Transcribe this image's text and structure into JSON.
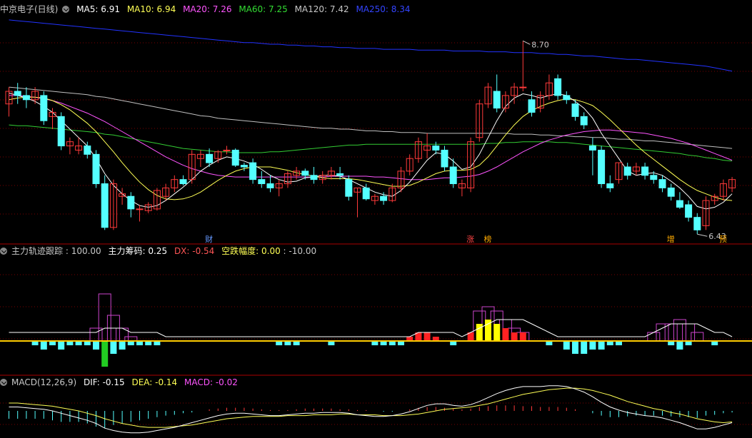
{
  "colors": {
    "bg": "#000000",
    "grid": "#7a0000",
    "up": "#ff3a3a",
    "down": "#54ffff",
    "ma5": "#ffffff",
    "ma10": "#ffff55",
    "ma20": "#ff55ff",
    "ma60": "#33cc33",
    "ma120": "#c0c0c0",
    "ma250": "#2233ff"
  },
  "header": {
    "stock": "中京电子(日线)",
    "ma5": "MA5: 6.91",
    "ma10": "MA10: 6.94",
    "ma20": "MA20: 7.26",
    "ma60": "MA60: 7.25",
    "ma120": "MA120: 7.42",
    "ma250": "MA250: 8.34"
  },
  "indicator": {
    "name": "主力轨迹跟踪",
    "v1": ": 100.00",
    "v2": "主力筹码: 0.25",
    "v3": "DX: -0.54",
    "v4": "空跌幅度: 0.00",
    "v5": ": -10.00"
  },
  "macd": {
    "name": "MACD(12,26,9)",
    "dif": "DIF: -0.15",
    "dea": "DEA: -0.14",
    "macd": "MACD: -0.02"
  },
  "chart_data": {
    "type": "candlestick",
    "price_range": [
      6.3,
      9.0
    ],
    "high_label": "8.70",
    "low_label": "6.43",
    "markers": [
      {
        "idx": 23,
        "text": "财",
        "color": "#6699ff"
      },
      {
        "idx": 53,
        "text": "涨",
        "color": "#ff4444"
      },
      {
        "idx": 55,
        "text": "榜",
        "color": "#ffaa00"
      },
      {
        "idx": 76,
        "text": "增",
        "color": "#ffaa00"
      },
      {
        "idx": 82,
        "text": "预",
        "color": "#ffaa00"
      }
    ],
    "ohlc": [
      [
        7.95,
        8.15,
        7.8,
        8.1
      ],
      [
        8.1,
        8.2,
        7.95,
        8.05
      ],
      [
        8.05,
        8.15,
        7.9,
        8.0
      ],
      [
        8.0,
        8.15,
        7.95,
        8.1
      ],
      [
        8.05,
        8.1,
        7.7,
        7.75
      ],
      [
        7.8,
        7.9,
        7.65,
        7.85
      ],
      [
        7.8,
        7.85,
        7.4,
        7.45
      ],
      [
        7.45,
        7.55,
        7.35,
        7.5
      ],
      [
        7.4,
        7.55,
        7.35,
        7.45
      ],
      [
        7.45,
        7.5,
        7.3,
        7.35
      ],
      [
        7.35,
        7.4,
        6.95,
        7.0
      ],
      [
        7.0,
        7.1,
        6.45,
        6.48
      ],
      [
        6.48,
        7.05,
        6.45,
        7.0
      ],
      [
        6.85,
        6.95,
        6.75,
        6.88
      ],
      [
        6.85,
        6.9,
        6.6,
        6.7
      ],
      [
        6.7,
        6.75,
        6.55,
        6.7
      ],
      [
        6.68,
        6.78,
        6.65,
        6.75
      ],
      [
        6.7,
        6.95,
        6.68,
        6.92
      ],
      [
        6.85,
        7.0,
        6.8,
        6.95
      ],
      [
        6.95,
        7.1,
        6.9,
        7.05
      ],
      [
        7.05,
        7.1,
        6.98,
        7.0
      ],
      [
        7.05,
        7.4,
        7.0,
        7.35
      ],
      [
        7.3,
        7.4,
        7.2,
        7.35
      ],
      [
        7.35,
        7.42,
        7.2,
        7.25
      ],
      [
        7.3,
        7.4,
        7.25,
        7.38
      ],
      [
        7.4,
        7.45,
        7.35,
        7.4
      ],
      [
        7.4,
        7.42,
        7.2,
        7.22
      ],
      [
        7.22,
        7.25,
        7.15,
        7.2
      ],
      [
        7.25,
        7.3,
        7.0,
        7.05
      ],
      [
        7.05,
        7.15,
        6.95,
        7.0
      ],
      [
        7.0,
        7.1,
        6.9,
        6.95
      ],
      [
        6.95,
        7.05,
        6.85,
        7.0
      ],
      [
        7.0,
        7.15,
        6.95,
        7.12
      ],
      [
        7.1,
        7.2,
        7.05,
        7.15
      ],
      [
        7.15,
        7.18,
        7.05,
        7.1
      ],
      [
        7.1,
        7.2,
        7.0,
        7.05
      ],
      [
        7.05,
        7.15,
        7.0,
        7.1
      ],
      [
        7.1,
        7.2,
        7.05,
        7.15
      ],
      [
        7.12,
        7.2,
        7.05,
        7.1
      ],
      [
        7.05,
        7.1,
        6.8,
        6.85
      ],
      [
        6.9,
        6.95,
        6.6,
        6.95
      ],
      [
        6.95,
        7.0,
        6.8,
        6.82
      ],
      [
        6.8,
        6.88,
        6.75,
        6.85
      ],
      [
        6.85,
        6.9,
        6.75,
        6.8
      ],
      [
        6.8,
        7.0,
        6.78,
        6.95
      ],
      [
        6.95,
        7.2,
        6.9,
        7.15
      ],
      [
        7.15,
        7.35,
        7.1,
        7.3
      ],
      [
        7.3,
        7.55,
        7.25,
        7.5
      ],
      [
        7.4,
        7.6,
        7.3,
        7.45
      ],
      [
        7.45,
        7.5,
        7.35,
        7.4
      ],
      [
        7.4,
        7.45,
        7.15,
        7.2
      ],
      [
        7.2,
        7.3,
        6.95,
        7.0
      ],
      [
        6.95,
        7.05,
        6.85,
        7.0
      ],
      [
        6.95,
        7.55,
        6.9,
        7.5
      ],
      [
        7.55,
        8.0,
        7.5,
        7.95
      ],
      [
        7.95,
        8.2,
        7.9,
        8.15
      ],
      [
        8.1,
        8.3,
        7.85,
        7.9
      ],
      [
        7.9,
        8.1,
        7.85,
        8.05
      ],
      [
        8.05,
        8.2,
        7.95,
        8.15
      ],
      [
        8.15,
        8.7,
        8.1,
        8.15
      ],
      [
        8.0,
        8.1,
        7.8,
        7.85
      ],
      [
        7.9,
        8.1,
        7.85,
        8.05
      ],
      [
        8.05,
        8.3,
        8.0,
        8.2
      ],
      [
        8.25,
        8.3,
        8.0,
        8.05
      ],
      [
        8.05,
        8.1,
        7.95,
        8.0
      ],
      [
        7.95,
        8.0,
        7.75,
        7.8
      ],
      [
        7.8,
        7.85,
        7.65,
        7.7
      ],
      [
        7.45,
        7.55,
        7.1,
        7.4
      ],
      [
        7.4,
        7.45,
        6.95,
        7.0
      ],
      [
        7.0,
        7.1,
        6.9,
        6.95
      ],
      [
        7.05,
        7.25,
        7.0,
        7.25
      ],
      [
        7.2,
        7.25,
        7.05,
        7.1
      ],
      [
        7.15,
        7.25,
        7.1,
        7.2
      ],
      [
        7.2,
        7.25,
        7.05,
        7.1
      ],
      [
        7.1,
        7.15,
        7.0,
        7.05
      ],
      [
        7.05,
        7.1,
        6.9,
        6.95
      ],
      [
        6.95,
        7.0,
        6.8,
        6.85
      ],
      [
        6.8,
        6.9,
        6.7,
        6.72
      ],
      [
        6.75,
        6.8,
        6.55,
        6.6
      ],
      [
        6.6,
        6.65,
        6.4,
        6.45
      ],
      [
        6.5,
        6.85,
        6.45,
        6.8
      ],
      [
        6.8,
        6.88,
        6.75,
        6.85
      ],
      [
        6.85,
        7.05,
        6.8,
        7.0
      ],
      [
        6.95,
        7.08,
        6.9,
        7.05
      ]
    ],
    "ma": {
      "ma5": [
        8.08,
        8.05,
        8.02,
        7.98,
        7.92,
        7.85,
        7.75,
        7.65,
        7.55,
        7.45,
        7.3,
        7.12,
        6.98,
        6.88,
        6.8,
        6.74,
        6.72,
        6.74,
        6.8,
        6.88,
        6.96,
        7.05,
        7.15,
        7.22,
        7.28,
        7.32,
        7.3,
        7.27,
        7.23,
        7.17,
        7.1,
        7.05,
        7.02,
        7.03,
        7.07,
        7.08,
        7.1,
        7.1,
        7.09,
        7.05,
        7.0,
        6.95,
        6.9,
        6.87,
        6.85,
        6.92,
        7.02,
        7.15,
        7.28,
        7.37,
        7.35,
        7.27,
        7.17,
        7.2,
        7.35,
        7.55,
        7.75,
        7.92,
        8.02,
        8.07,
        8.05,
        8.02,
        8.05,
        8.07,
        8.05,
        7.98,
        7.9,
        7.78,
        7.6,
        7.45,
        7.3,
        7.15,
        7.1,
        7.12,
        7.13,
        7.1,
        7.03,
        6.95,
        6.85,
        6.73,
        6.7,
        6.72,
        6.78,
        6.88
      ],
      "ma10": [
        8.0,
        8.02,
        8.03,
        8.03,
        8.02,
        7.99,
        7.94,
        7.88,
        7.8,
        7.72,
        7.62,
        7.5,
        7.38,
        7.25,
        7.13,
        7.02,
        6.93,
        6.86,
        6.82,
        6.81,
        6.82,
        6.85,
        6.9,
        6.97,
        7.04,
        7.1,
        7.15,
        7.18,
        7.2,
        7.2,
        7.2,
        7.18,
        7.16,
        7.13,
        7.11,
        7.09,
        7.07,
        7.06,
        7.06,
        7.06,
        7.05,
        7.03,
        7.01,
        6.99,
        6.97,
        6.97,
        6.98,
        7.02,
        7.07,
        7.12,
        7.15,
        7.16,
        7.16,
        7.17,
        7.22,
        7.32,
        7.45,
        7.58,
        7.7,
        7.8,
        7.87,
        7.92,
        7.96,
        7.99,
        8.01,
        8.0,
        7.97,
        7.93,
        7.85,
        7.76,
        7.66,
        7.56,
        7.46,
        7.37,
        7.29,
        7.21,
        7.13,
        7.05,
        6.98,
        6.92,
        6.88,
        6.84,
        6.81,
        6.8
      ],
      "ma20": [
        8.05,
        8.05,
        8.04,
        8.03,
        8.01,
        7.99,
        7.96,
        7.92,
        7.88,
        7.84,
        7.79,
        7.74,
        7.68,
        7.62,
        7.56,
        7.5,
        7.44,
        7.38,
        7.32,
        7.27,
        7.22,
        7.18,
        7.15,
        7.12,
        7.1,
        7.09,
        7.08,
        7.08,
        7.08,
        7.08,
        7.08,
        7.08,
        7.08,
        7.08,
        7.08,
        7.08,
        7.08,
        7.09,
        7.09,
        7.09,
        7.09,
        7.09,
        7.08,
        7.08,
        7.07,
        7.06,
        7.05,
        7.05,
        7.05,
        7.06,
        7.07,
        7.07,
        7.08,
        7.09,
        7.11,
        7.15,
        7.2,
        7.26,
        7.32,
        7.38,
        7.43,
        7.48,
        7.52,
        7.55,
        7.58,
        7.6,
        7.62,
        7.63,
        7.64,
        7.64,
        7.63,
        7.62,
        7.61,
        7.6,
        7.58,
        7.56,
        7.54,
        7.51,
        7.48,
        7.44,
        7.4,
        7.36,
        7.32,
        7.28
      ],
      "ma60": [
        7.7,
        7.69,
        7.69,
        7.68,
        7.67,
        7.66,
        7.65,
        7.64,
        7.63,
        7.62,
        7.61,
        7.59,
        7.58,
        7.56,
        7.54,
        7.52,
        7.5,
        7.48,
        7.46,
        7.44,
        7.42,
        7.41,
        7.4,
        7.39,
        7.38,
        7.38,
        7.37,
        7.37,
        7.37,
        7.37,
        7.38,
        7.38,
        7.39,
        7.4,
        7.41,
        7.42,
        7.43,
        7.44,
        7.45,
        7.46,
        7.46,
        7.47,
        7.47,
        7.47,
        7.47,
        7.47,
        7.47,
        7.47,
        7.47,
        7.47,
        7.47,
        7.47,
        7.47,
        7.47,
        7.47,
        7.48,
        7.48,
        7.49,
        7.49,
        7.5,
        7.5,
        7.5,
        7.5,
        7.49,
        7.49,
        7.48,
        7.47,
        7.46,
        7.45,
        7.44,
        7.43,
        7.42,
        7.41,
        7.4,
        7.39,
        7.38,
        7.37,
        7.36,
        7.34,
        7.33,
        7.31,
        7.3,
        7.28,
        7.27
      ],
      "ma120": [
        8.15,
        8.14,
        8.13,
        8.12,
        8.11,
        8.1,
        8.09,
        8.08,
        8.07,
        8.06,
        8.04,
        8.03,
        8.01,
        7.99,
        7.97,
        7.95,
        7.93,
        7.91,
        7.89,
        7.87,
        7.85,
        7.83,
        7.81,
        7.8,
        7.78,
        7.77,
        7.76,
        7.75,
        7.74,
        7.73,
        7.72,
        7.71,
        7.7,
        7.69,
        7.68,
        7.67,
        7.66,
        7.66,
        7.65,
        7.65,
        7.64,
        7.63,
        7.63,
        7.62,
        7.62,
        7.61,
        7.61,
        7.61,
        7.6,
        7.6,
        7.6,
        7.6,
        7.6,
        7.6,
        7.6,
        7.6,
        7.6,
        7.6,
        7.59,
        7.59,
        7.59,
        7.58,
        7.58,
        7.57,
        7.57,
        7.56,
        7.56,
        7.55,
        7.55,
        7.54,
        7.53,
        7.53,
        7.52,
        7.51,
        7.51,
        7.5,
        7.49,
        7.48,
        7.47,
        7.46,
        7.45,
        7.44,
        7.43,
        7.42
      ],
      "ma250": [
        8.95,
        8.94,
        8.93,
        8.92,
        8.91,
        8.9,
        8.89,
        8.88,
        8.87,
        8.86,
        8.85,
        8.84,
        8.83,
        8.82,
        8.81,
        8.8,
        8.79,
        8.78,
        8.77,
        8.76,
        8.75,
        8.74,
        8.73,
        8.72,
        8.71,
        8.7,
        8.69,
        8.68,
        8.68,
        8.67,
        8.66,
        8.66,
        8.65,
        8.65,
        8.64,
        8.64,
        8.63,
        8.63,
        8.62,
        8.62,
        8.61,
        8.61,
        8.61,
        8.6,
        8.6,
        8.6,
        8.6,
        8.59,
        8.59,
        8.59,
        8.59,
        8.58,
        8.58,
        8.58,
        8.58,
        8.57,
        8.57,
        8.57,
        8.56,
        8.56,
        8.56,
        8.55,
        8.55,
        8.54,
        8.54,
        8.53,
        8.52,
        8.52,
        8.51,
        8.5,
        8.49,
        8.48,
        8.48,
        8.47,
        8.46,
        8.45,
        8.44,
        8.43,
        8.42,
        8.41,
        8.4,
        8.38,
        8.36,
        8.34
      ]
    },
    "indicator_bars": [
      0,
      0,
      0,
      -1,
      -2,
      -1,
      -2,
      -1,
      -1,
      -1,
      -2,
      -6,
      -3,
      -2,
      -1,
      -1,
      -1,
      -1,
      0,
      0,
      0,
      0,
      0,
      0,
      0,
      0,
      0,
      0,
      0,
      0,
      0,
      -1,
      -1,
      -1,
      0,
      0,
      0,
      -1,
      0,
      0,
      0,
      0,
      -1,
      -1,
      -1,
      -1,
      1,
      2,
      2,
      1,
      0,
      -1,
      0,
      2,
      4,
      5,
      4,
      3,
      2,
      2,
      0,
      0,
      -1,
      0,
      -2,
      -3,
      -3,
      -2,
      -2,
      -1,
      -1,
      0,
      0,
      0,
      0,
      0,
      -1,
      -2,
      -1,
      0,
      0,
      -1,
      0,
      0
    ],
    "indicator_hist": [
      0,
      0,
      0,
      0,
      0,
      0,
      0,
      0,
      0,
      0,
      3,
      11,
      6,
      3,
      1,
      0,
      0,
      0,
      0,
      0,
      0,
      0,
      0,
      0,
      0,
      0,
      0,
      0,
      0,
      0,
      0,
      0,
      0,
      0,
      0,
      0,
      0,
      0,
      0,
      0,
      0,
      0,
      0,
      0,
      0,
      0,
      0,
      0,
      0,
      0,
      0,
      0,
      0,
      0,
      7,
      8,
      7,
      5,
      3,
      2,
      0,
      0,
      0,
      0,
      0,
      0,
      0,
      0,
      0,
      0,
      0,
      0,
      0,
      0,
      2,
      4,
      4,
      5,
      4,
      2,
      0,
      0,
      0,
      0
    ],
    "indicator_line": [
      1,
      1,
      1,
      1,
      1,
      1,
      1,
      1,
      1,
      1,
      1,
      2,
      2,
      2,
      1,
      1,
      1,
      1,
      0,
      0,
      0,
      0,
      0,
      0,
      0,
      0,
      0,
      0,
      0,
      0,
      0,
      0,
      0,
      0,
      0,
      0,
      0,
      0,
      0,
      0,
      0,
      0,
      0,
      0,
      0,
      0,
      0,
      1,
      1,
      1,
      1,
      1,
      0,
      1,
      2,
      3,
      4,
      4,
      4,
      4,
      3,
      2,
      1,
      0,
      0,
      0,
      0,
      0,
      0,
      0,
      0,
      0,
      0,
      0,
      1,
      2,
      3,
      3,
      3,
      3,
      2,
      1,
      1,
      0
    ],
    "macd_hist": [
      -0.1,
      -0.1,
      -0.1,
      -0.1,
      -0.1,
      -0.12,
      -0.14,
      -0.14,
      -0.14,
      -0.16,
      -0.2,
      -0.22,
      -0.18,
      -0.16,
      -0.14,
      -0.12,
      -0.1,
      -0.08,
      -0.06,
      -0.05,
      -0.03,
      -0.02,
      0.0,
      0.02,
      0.03,
      0.04,
      0.04,
      0.04,
      0.03,
      0.02,
      0.01,
      0.01,
      0.01,
      0.02,
      0.03,
      0.03,
      0.03,
      0.03,
      0.02,
      0.02,
      0.01,
      0.01,
      0.0,
      -0.01,
      -0.01,
      0.0,
      0.02,
      0.04,
      0.05,
      0.05,
      0.04,
      0.03,
      0.02,
      0.03,
      0.05,
      0.06,
      0.07,
      0.07,
      0.07,
      0.06,
      0.06,
      0.05,
      0.05,
      0.05,
      0.04,
      0.02,
      0.0,
      -0.03,
      -0.06,
      -0.08,
      -0.08,
      -0.07,
      -0.06,
      -0.06,
      -0.06,
      -0.06,
      -0.07,
      -0.08,
      -0.08,
      -0.09,
      -0.06,
      -0.05,
      -0.03,
      -0.02
    ],
    "macd_dif": [
      0.05,
      0.05,
      0.04,
      0.03,
      0.02,
      0.0,
      -0.03,
      -0.06,
      -0.09,
      -0.12,
      -0.16,
      -0.22,
      -0.25,
      -0.27,
      -0.28,
      -0.28,
      -0.27,
      -0.25,
      -0.23,
      -0.21,
      -0.18,
      -0.15,
      -0.12,
      -0.09,
      -0.06,
      -0.04,
      -0.03,
      -0.03,
      -0.04,
      -0.05,
      -0.06,
      -0.06,
      -0.05,
      -0.04,
      -0.03,
      -0.03,
      -0.02,
      -0.02,
      -0.02,
      -0.03,
      -0.05,
      -0.06,
      -0.07,
      -0.07,
      -0.06,
      -0.04,
      -0.01,
      0.03,
      0.07,
      0.09,
      0.09,
      0.07,
      0.06,
      0.08,
      0.12,
      0.17,
      0.22,
      0.26,
      0.29,
      0.31,
      0.31,
      0.31,
      0.32,
      0.32,
      0.31,
      0.28,
      0.24,
      0.18,
      0.11,
      0.05,
      0.01,
      -0.02,
      -0.04,
      -0.06,
      -0.07,
      -0.09,
      -0.12,
      -0.15,
      -0.19,
      -0.23,
      -0.23,
      -0.21,
      -0.18,
      -0.15
    ],
    "macd_dea": [
      0.1,
      0.1,
      0.09,
      0.08,
      0.07,
      0.06,
      0.04,
      0.02,
      0.0,
      -0.03,
      -0.06,
      -0.1,
      -0.13,
      -0.16,
      -0.18,
      -0.2,
      -0.21,
      -0.21,
      -0.21,
      -0.2,
      -0.19,
      -0.18,
      -0.16,
      -0.14,
      -0.12,
      -0.1,
      -0.09,
      -0.08,
      -0.07,
      -0.07,
      -0.07,
      -0.07,
      -0.06,
      -0.06,
      -0.06,
      -0.05,
      -0.05,
      -0.05,
      -0.04,
      -0.04,
      -0.05,
      -0.05,
      -0.05,
      -0.06,
      -0.06,
      -0.06,
      -0.05,
      -0.04,
      -0.02,
      0.0,
      0.02,
      0.03,
      0.04,
      0.05,
      0.07,
      0.09,
      0.12,
      0.15,
      0.18,
      0.21,
      0.23,
      0.25,
      0.27,
      0.28,
      0.29,
      0.29,
      0.28,
      0.26,
      0.23,
      0.2,
      0.16,
      0.12,
      0.09,
      0.06,
      0.03,
      0.01,
      -0.02,
      -0.04,
      -0.07,
      -0.1,
      -0.12,
      -0.14,
      -0.15,
      -0.14
    ]
  }
}
